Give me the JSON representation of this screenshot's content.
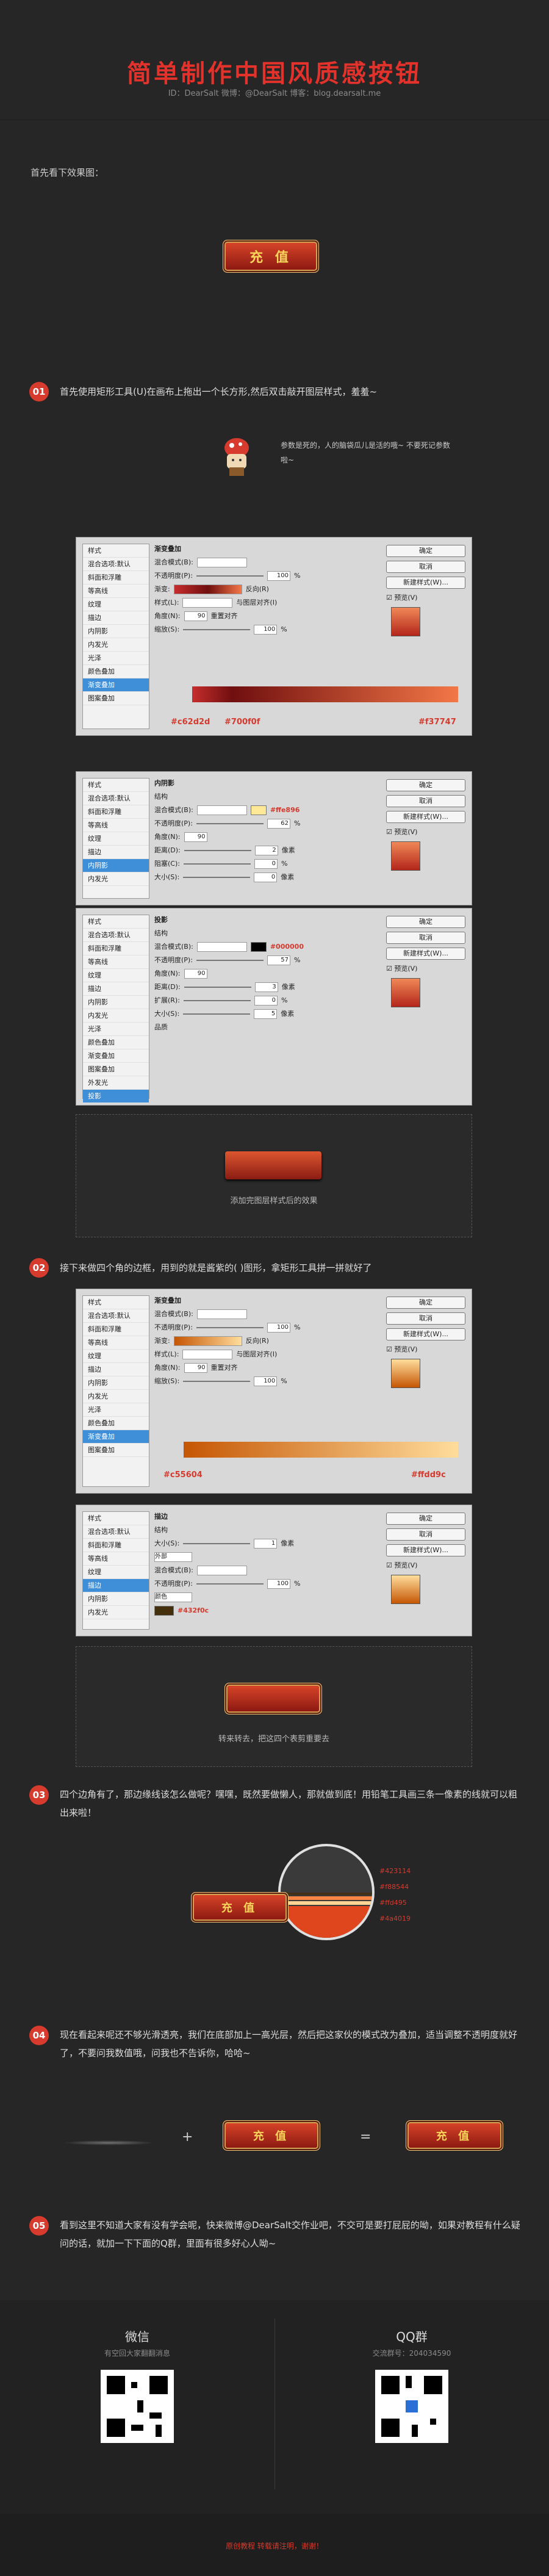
{
  "header": {
    "title": "简单制作中国风质感按钮",
    "subtitle": "ID：DearSalt   微博：@DearSalt   博客：blog.dearsalt.me"
  },
  "intro": "首先看下效果图：",
  "button_label": "充 值",
  "steps": [
    {
      "num": "01",
      "text": "首先使用矩形工具(U)在画布上拖出一个长方形,然后双击敲开图层样式，羞羞~"
    },
    {
      "num": "02",
      "text": "接下来做四个角的边框，用到的就是酱紫的(  )图形，拿矩形工具拼一拼就好了"
    },
    {
      "num": "03",
      "text": "四个边角有了，那边缘线该怎么做呢？嘿嘿，既然要做懒人，那就做到底！用铅笔工具画三条一像素的线就可以粗出来啦！"
    },
    {
      "num": "04",
      "text": "现在看起来呢还不够光滑透亮，我们在底部加上一高光层，然后把这家伙的模式改为叠加，适当调整不透明度就好了，不要问我数值哦，问我也不告诉你，哈哈~"
    },
    {
      "num": "05",
      "text": "看到这里不知道大家有没有学会呢，快来微博@DearSalt交作业吧，不交可是要打屁屁的呦，如果对教程有什么疑问的话，就加一下下面的Q群，里面有很多好心人呦~"
    }
  ],
  "mascot_note": "参数是死的，人的脑袋瓜儿是活的哦~ 不要死记参数啦~",
  "ps_dialogs": {
    "style_label": "样式",
    "blend_default": "混合选项:默认",
    "items": [
      "斜面和浮雕",
      "等高线",
      "纹理",
      "描边",
      "内阴影",
      "内发光",
      "光泽",
      "颜色叠加",
      "渐变叠加",
      "图案叠加",
      "外发光",
      "投影"
    ],
    "ok": "确定",
    "cancel": "取消",
    "new_style": "新建样式(W)...",
    "preview": "预览(V)",
    "gradient_overlay": "渐变叠加",
    "inner_shadow": "内阴影",
    "drop_shadow": "投影",
    "stroke": "描边",
    "blend_mode_label": "混合模式(B):",
    "blend_normal": "正常",
    "opacity_label": "不透明度(P):",
    "gradient_label": "渐变:",
    "style_field_label": "样式(L):",
    "style_linear": "线性",
    "angle_label": "角度(N):",
    "angle_value": "90",
    "scale_label": "缩放(S):",
    "scale_value": "100",
    "reverse": "反向(R)",
    "align_layer": "与图层对齐(I)",
    "reset": "重置对齐",
    "distance_label": "距离(D):",
    "choke_label": "阻塞(C):",
    "spread_label": "扩展(R):",
    "size_label": "大小(S):",
    "px": "像素",
    "percent": "%",
    "structure": "结构",
    "quality": "品质"
  },
  "gradient1": {
    "stops": [
      "#c62d2d",
      "#700f0f",
      "#f37747"
    ]
  },
  "inner_shadow_color": "#ffe896",
  "drop_shadow_color": "#000000",
  "step1_caption": "添加完图层样式后的效果",
  "gradient2": {
    "stops": [
      "#c55604",
      "#ffdd9c"
    ]
  },
  "stroke_color": "#432f0c",
  "stroke_position": "外部",
  "stroke_fill_type": "颜色",
  "step2_caption": "转来转去，把这四个表剪重要去",
  "line_colors": [
    "#423114",
    "#f88544",
    "#ffd495",
    "#4a4019"
  ],
  "step4_ops": {
    "plus": "+",
    "equals": "="
  },
  "wechat": {
    "title": "微信",
    "desc": "有空回大家翻翻消息"
  },
  "qq": {
    "title": "QQ群",
    "desc": "交流群号：204034590"
  },
  "footer": "原创教程 转载请注明，谢谢！",
  "colors": {
    "accent": "#d63b2e",
    "title": "#e2322b"
  }
}
